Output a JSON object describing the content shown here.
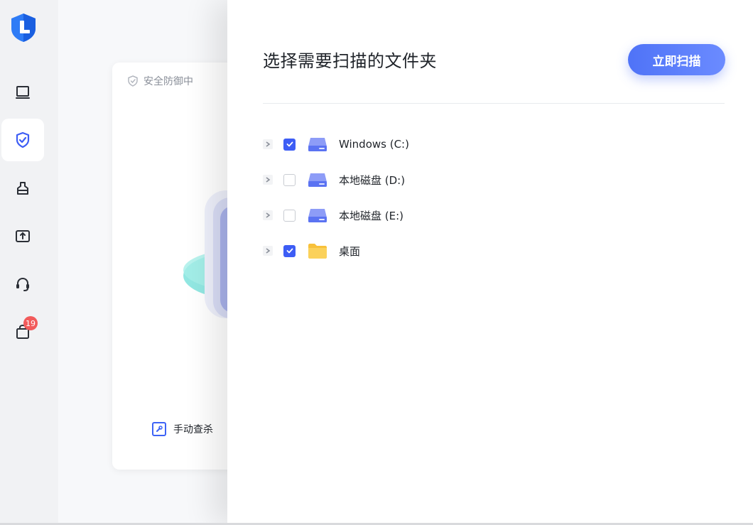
{
  "sidebar": {
    "items": [
      {
        "icon": "monitor-icon"
      },
      {
        "icon": "shield-check-icon",
        "active": true
      },
      {
        "icon": "broom-icon"
      },
      {
        "icon": "upload-box-icon"
      },
      {
        "icon": "headset-icon"
      },
      {
        "icon": "shopping-bag-icon",
        "badge": "19"
      }
    ]
  },
  "card": {
    "status_text": "安全防御中",
    "manual_scan_label": "手动查杀"
  },
  "panel": {
    "title": "选择需要扫描的文件夹",
    "scan_button": "立即扫描",
    "items": [
      {
        "label": "Windows (C:)",
        "checked": true,
        "icon": "drive-icon"
      },
      {
        "label": "本地磁盘 (D:)",
        "checked": false,
        "icon": "drive-icon"
      },
      {
        "label": "本地磁盘 (E:)",
        "checked": false,
        "icon": "drive-icon"
      },
      {
        "label": "桌面",
        "checked": true,
        "icon": "folder-icon"
      }
    ]
  },
  "colors": {
    "accent": "#3d5df5",
    "badge": "#f25b5b",
    "folder": "#f8c13a"
  }
}
